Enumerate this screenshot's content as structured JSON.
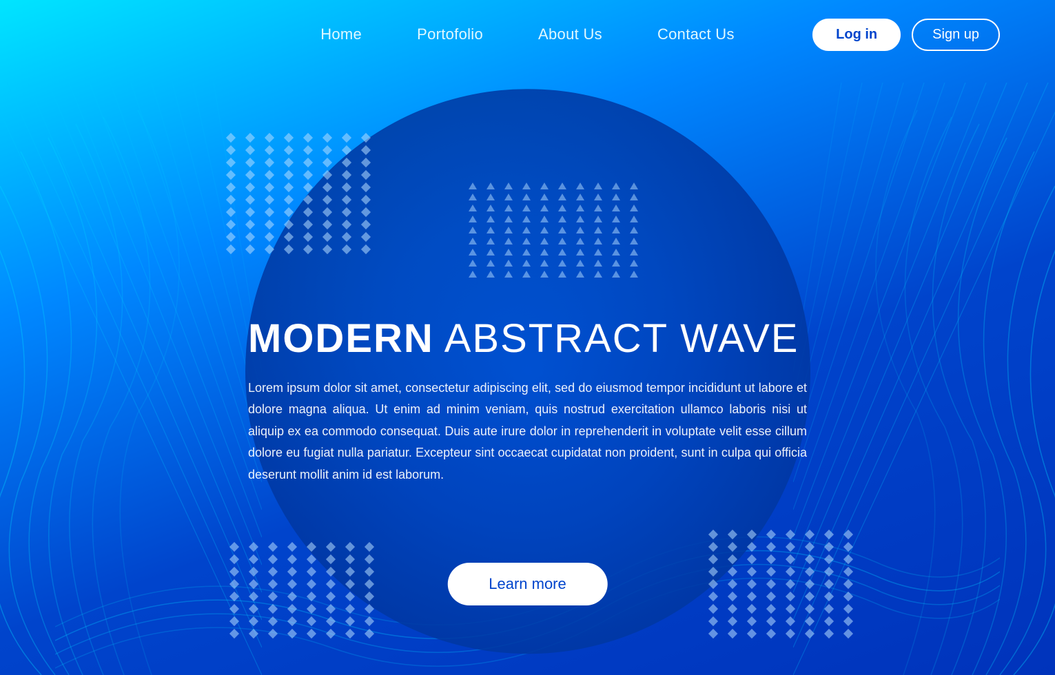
{
  "nav": {
    "links": [
      {
        "label": "Home",
        "id": "home"
      },
      {
        "label": "Portofolio",
        "id": "portfolio"
      },
      {
        "label": "About Us",
        "id": "about"
      },
      {
        "label": "Contact Us",
        "id": "contact"
      }
    ],
    "btn_login": "Log in",
    "btn_signup": "Sign up"
  },
  "hero": {
    "title_bold": "MODERN",
    "title_rest": " ABSTRACT WAVE",
    "description": "Lorem ipsum dolor sit amet, consectetur adipiscing elit, sed do eiusmod tempor incididunt ut labore et dolore magna aliqua. Ut enim ad minim veniam, quis nostrud exercitation ullamco laboris nisi ut aliquip ex ea commodo consequat. Duis aute irure dolor in reprehenderit in voluptate velit esse cillum dolore eu fugiat nulla pariatur. Excepteur sint occaecat cupidatat non proident, sunt in culpa qui officia deserunt mollit anim id est laborum.",
    "cta_label": "Learn more"
  }
}
